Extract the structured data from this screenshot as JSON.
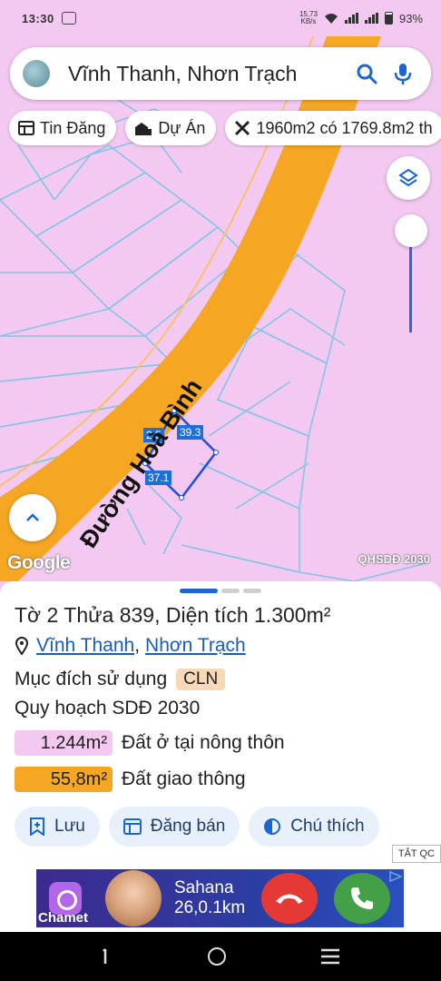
{
  "status_bar": {
    "time": "13:30",
    "network_speed": "15,73",
    "network_unit": "KB/s",
    "battery": "93%"
  },
  "search": {
    "query": "Vĩnh Thanh, Nhơn Trạch"
  },
  "chips": [
    {
      "label": "Tin Đăng",
      "icon": "listing-icon"
    },
    {
      "label": "Dự Án",
      "icon": "building-icon"
    },
    {
      "label": "1960m2 có 1769.8m2 th",
      "icon": "ruler-icon"
    }
  ],
  "map": {
    "road_label": "Đường Hoà Bình",
    "dimensions": [
      "39.3",
      "37.1",
      "2.5"
    ],
    "attribution": "Google",
    "layer_name": "QHSDĐ 2030",
    "colors": {
      "land": "#f3c9f1",
      "road": "#f5a623",
      "parcel_lines": "#84c5e6",
      "selected_parcel": "#1d4fd6"
    }
  },
  "parcel": {
    "title": "Tờ 2 Thửa 839, Diện tích 1.300m²",
    "ward": "Vĩnh Thanh",
    "district": "Nhơn Trạch",
    "purpose_label": "Mục đích sử dụng",
    "purpose_code": "CLN",
    "plan_label": "Quy hoạch SDĐ 2030",
    "land_use": [
      {
        "area": "1.244m²",
        "type": "Đất ở tại nông thôn",
        "color": "#f3c9f1"
      },
      {
        "area": "55,8m²",
        "type": "Đất giao thông",
        "color": "#f5a623"
      }
    ]
  },
  "actions": {
    "save": "Lưu",
    "post": "Đăng bán",
    "legend": "Chú thích"
  },
  "ad": {
    "tag": "TẮT QC",
    "brand": "Chamet",
    "name": "Sahana",
    "distance": "26,0.1km"
  }
}
